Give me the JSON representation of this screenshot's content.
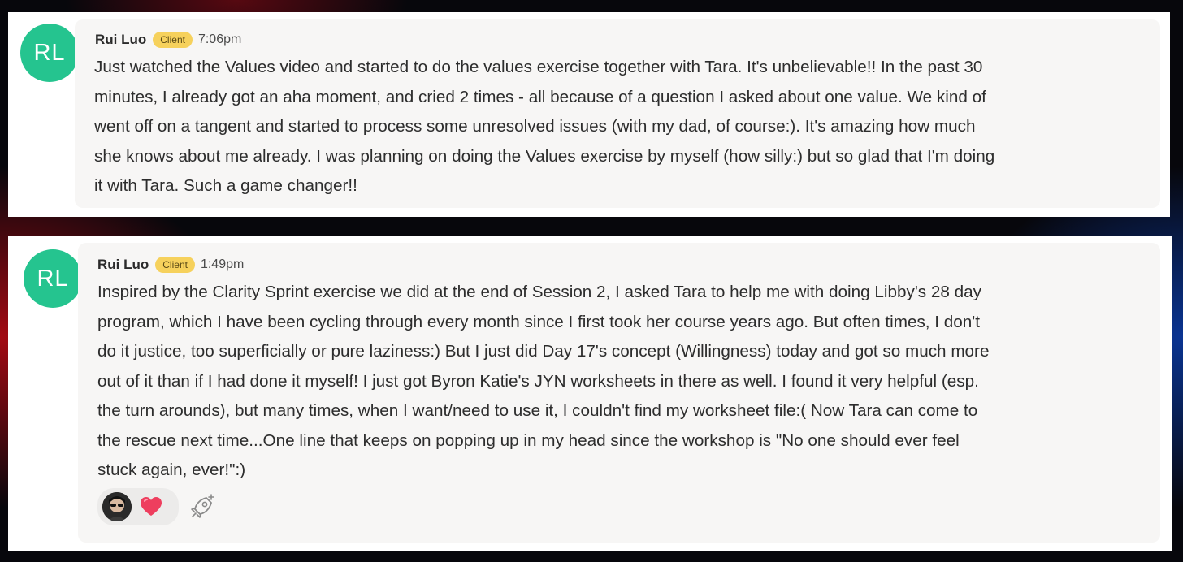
{
  "messages": [
    {
      "avatar_initials": "RL",
      "author": "Rui Luo",
      "badge": "Client",
      "time": "7:06pm",
      "lines": [
        "Just watched the Values video and started to do the values exercise together with Tara. It's unbelievable!! In the past 30",
        "minutes, I already got an aha moment, and cried 2 times - all because of a question I asked about one value. We kind of",
        "went off on a tangent and started to process some unresolved issues (with my dad, of course:). It's amazing how much",
        "she knows about me already. I was planning on doing the Values exercise by myself (how silly:) but so glad that I'm doing",
        "it with Tara. Such a game changer!!"
      ]
    },
    {
      "avatar_initials": "RL",
      "author": "Rui Luo",
      "badge": "Client",
      "time": "1:49pm",
      "lines": [
        "Inspired by the Clarity Sprint exercise we did at the end of Session 2, I asked Tara to help me with doing Libby's 28 day",
        "program, which I have been cycling through every month since I first took her course years ago. But often times, I don't",
        "do it justice, too superficially or pure laziness:) But I just did Day 17's concept (Willingness) today and got so much more",
        "out of it than if I had done it myself!  I just got Byron Katie's JYN worksheets in there as well. I found it very helpful (esp.",
        "the turn arounds), but many times, when I want/need to use it, I couldn't find my worksheet file:( Now Tara can come to",
        "the rescue next time...One line that keeps on popping up in my head since the workshop is \"No one should ever feel",
        "stuck again, ever!\":)"
      ],
      "reactions": [
        {
          "icon": "heart-icon",
          "user_icon": "user-avatar-icon"
        }
      ],
      "add_reaction_icon": "rocket-sparkle-icon"
    }
  ],
  "colors": {
    "avatar": "#25c48f",
    "badge": "#f6d15c",
    "bubble": "#f7f6f5",
    "heart": "#ee3e5e"
  }
}
